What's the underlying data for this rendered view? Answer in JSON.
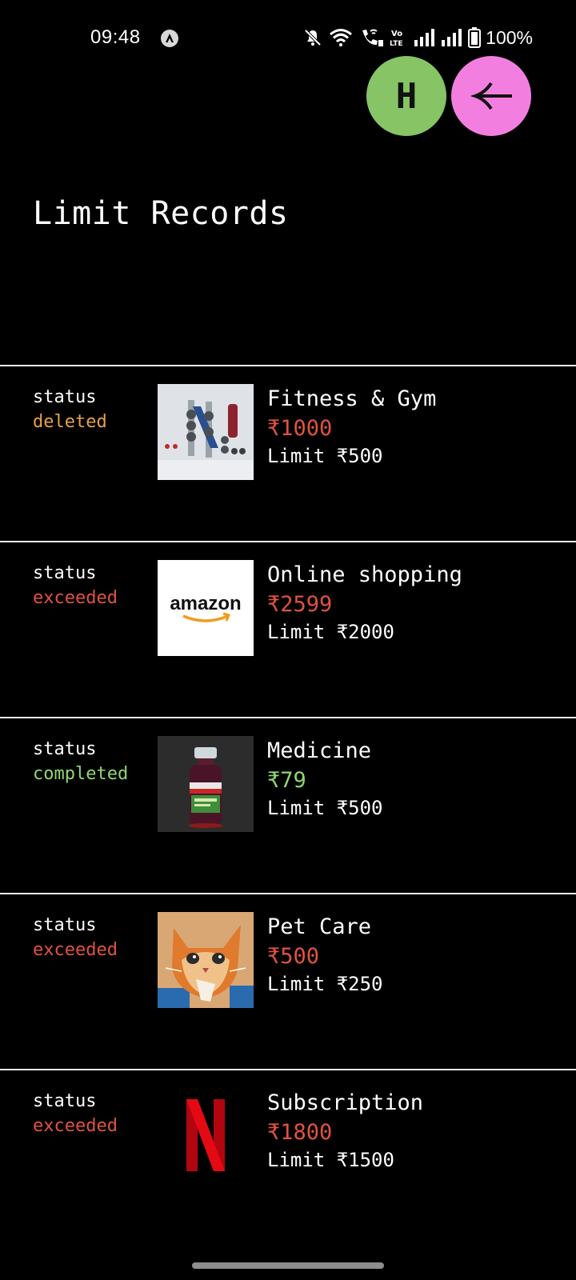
{
  "status_bar": {
    "time": "09:48",
    "battery": "100%",
    "icons": [
      "app-notification-icon",
      "mute-icon",
      "wifi-icon",
      "wifi-calling-icon",
      "volte-icon",
      "signal-icon",
      "signal-icon",
      "battery-icon"
    ]
  },
  "header": {
    "avatar_letter": "H",
    "avatar_color": "#86c466",
    "back_color": "#f27fe0"
  },
  "page_title": "Limit Records",
  "colors": {
    "deleted": "#e8a14a",
    "exceeded": "#e0533f",
    "completed": "#8fd870"
  },
  "records": [
    {
      "status_label": "status",
      "status": "deleted",
      "name": "Fitness & Gym",
      "amount": "₹1000",
      "limit": "Limit ₹500",
      "image": "gym-equipment"
    },
    {
      "status_label": "status",
      "status": "exceeded",
      "name": "Online shopping",
      "amount": "₹2599",
      "limit": "Limit ₹2000",
      "image": "amazon-logo",
      "image_text": "amazon"
    },
    {
      "status_label": "status",
      "status": "completed",
      "name": "Medicine",
      "amount": "₹79",
      "limit": "Limit ₹500",
      "image": "medicine-bottle"
    },
    {
      "status_label": "status",
      "status": "exceeded",
      "name": "Pet Care",
      "amount": "₹500",
      "limit": "Limit ₹250",
      "image": "cat-painting"
    },
    {
      "status_label": "status",
      "status": "exceeded",
      "name": "Subscription",
      "amount": "₹1800",
      "limit": "Limit ₹1500",
      "image": "netflix-logo"
    }
  ]
}
